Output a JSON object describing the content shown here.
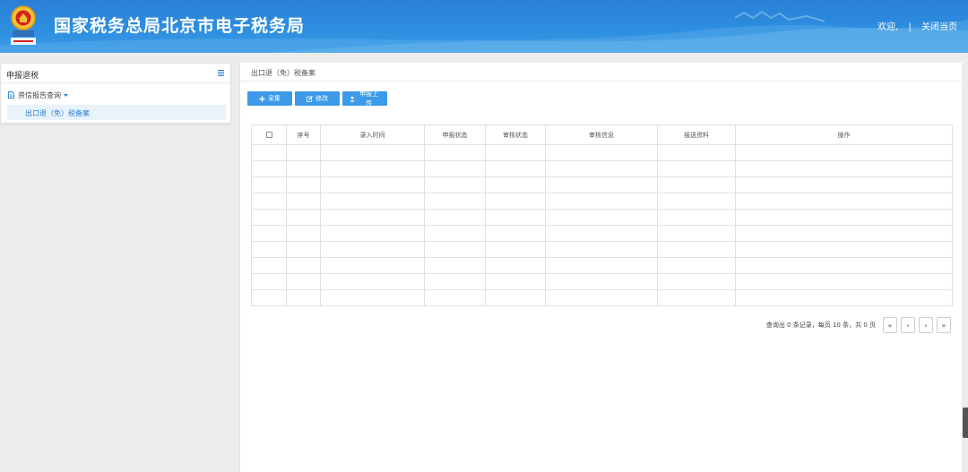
{
  "header": {
    "title": "国家税务总局北京市电子税务局",
    "welcome": "欢迎,",
    "separator": "|",
    "close_page": "关闭当页"
  },
  "sidebar": {
    "title": "申报退税",
    "group_label": "资信报告查询",
    "active_item": "出口退（免）税备案"
  },
  "breadcrumb": "出口退（免）税备案",
  "toolbar": {
    "add_label": "采集",
    "edit_label": "修改",
    "upload_label": "申报上传"
  },
  "table": {
    "columns": [
      "序号",
      "录入时间",
      "申报状态",
      "审核状态",
      "审核信息",
      "报送资料",
      "操作"
    ],
    "rows": []
  },
  "pager": {
    "info": "查询出 0 条记录，每页 10 条，共 0 页",
    "first": "«",
    "prev": "‹",
    "next": "›",
    "last": "»"
  },
  "colors": {
    "header_blue": "#2d8ee0",
    "button_blue": "#3c9ae8",
    "active_bg": "#e8f3fb",
    "active_text": "#2b7fd0"
  }
}
